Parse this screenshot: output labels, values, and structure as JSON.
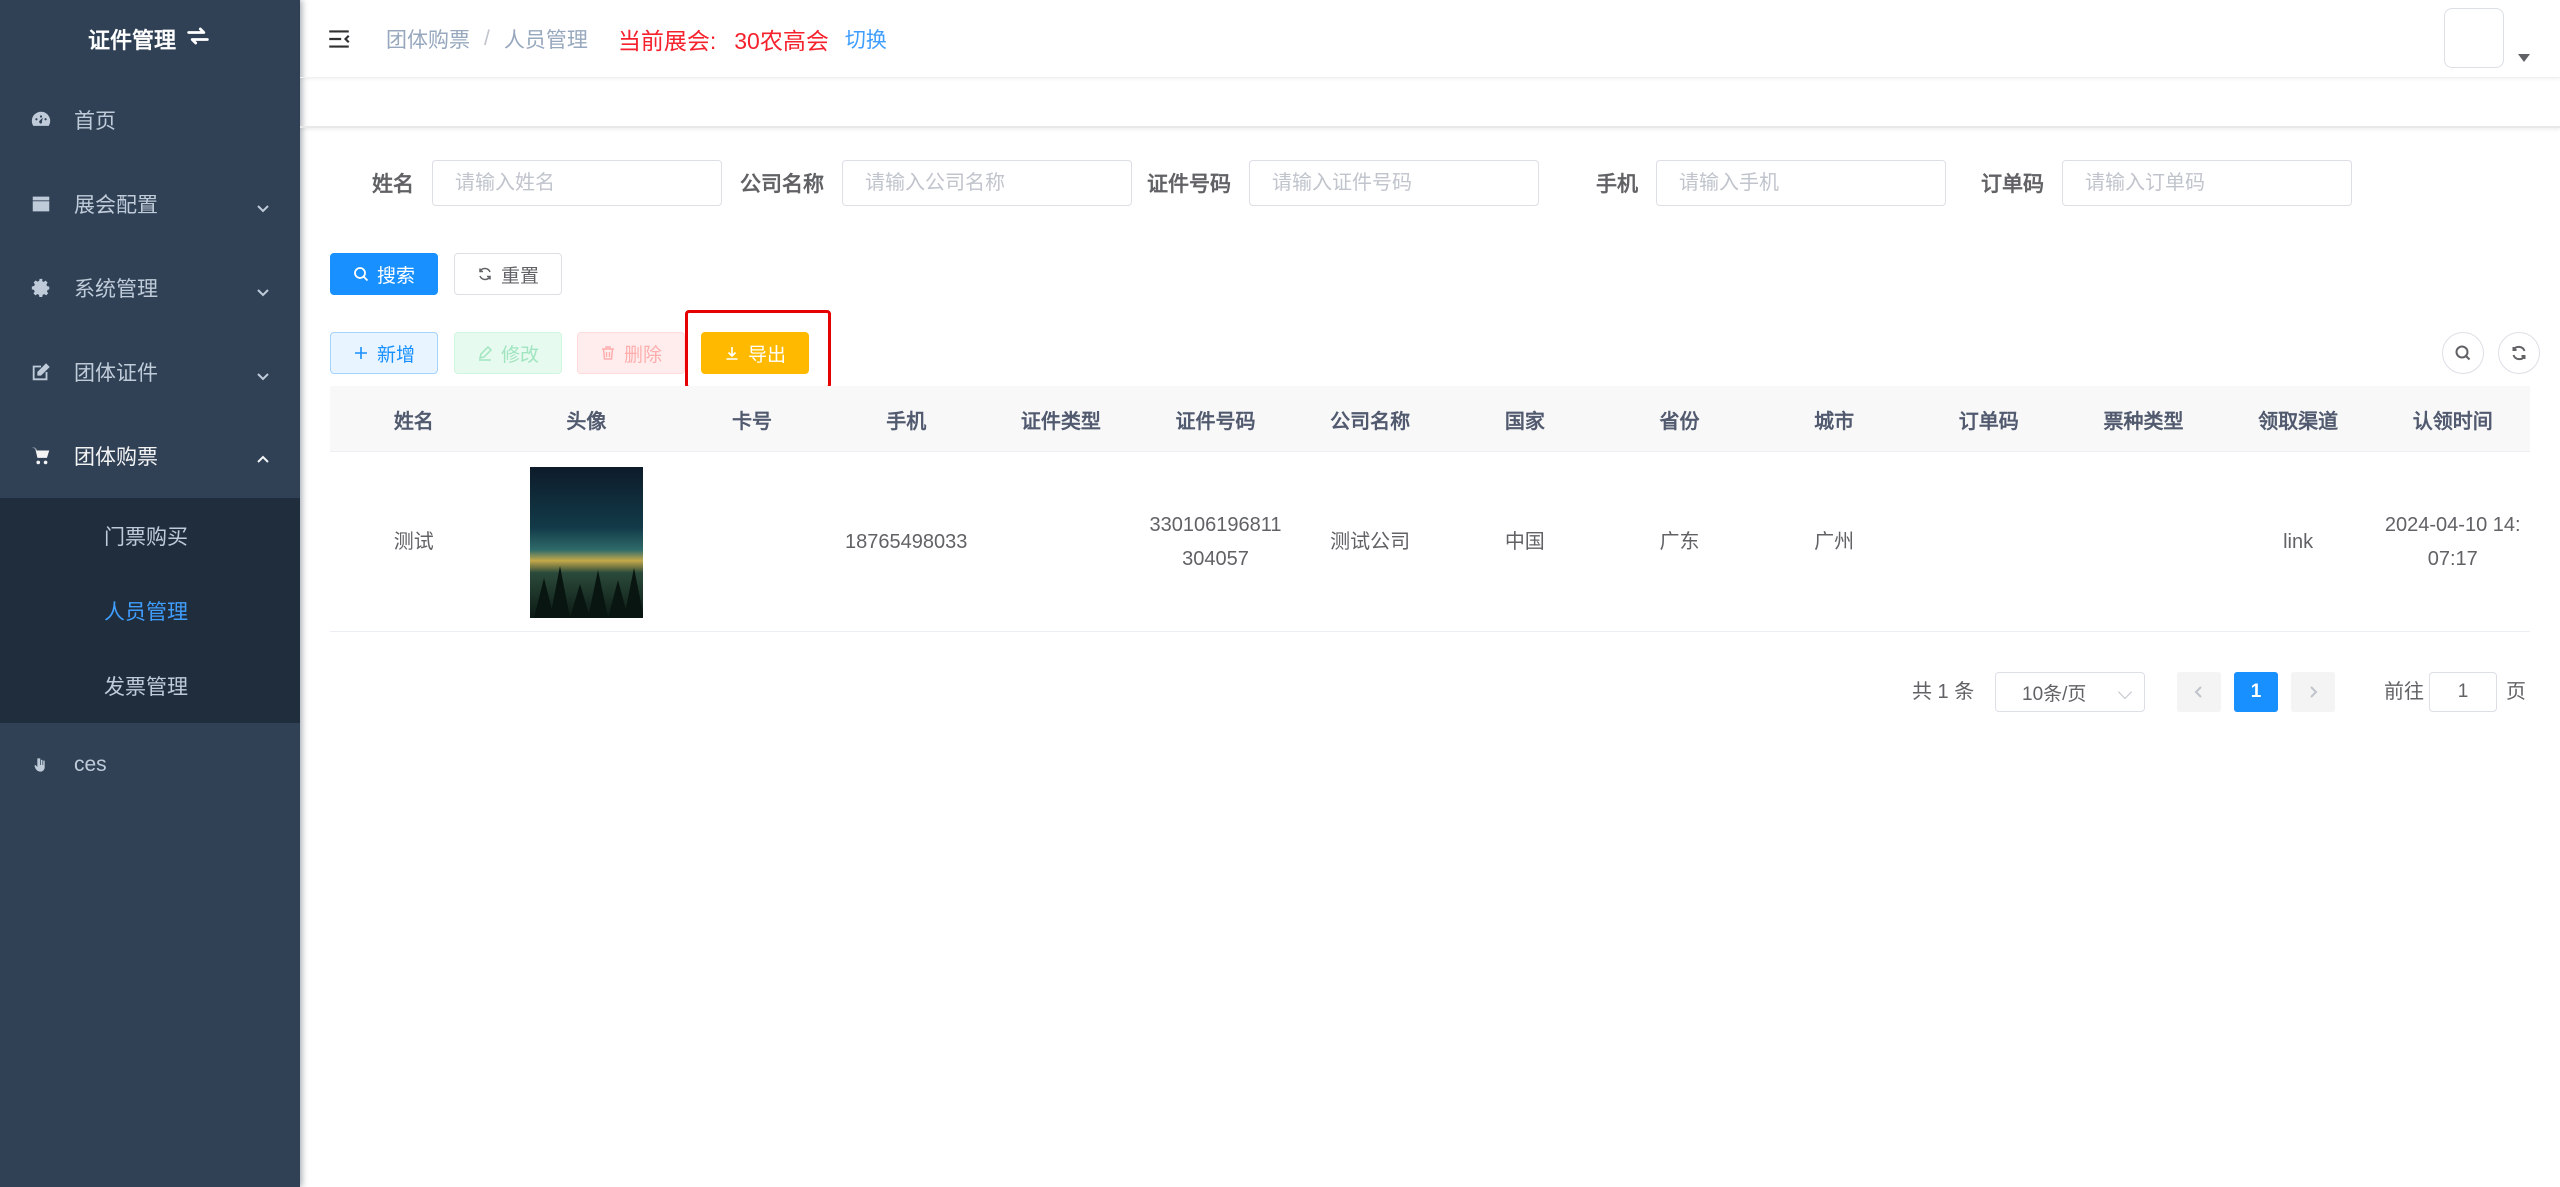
{
  "sidebar": {
    "logo_text": "证件管理",
    "menu": [
      {
        "label": "首页",
        "icon": "dashboard-icon"
      },
      {
        "label": "展会配置",
        "icon": "clapperboard-icon"
      },
      {
        "label": "系统管理",
        "icon": "gear-icon"
      },
      {
        "label": "团体证件",
        "icon": "edit-icon"
      },
      {
        "label": "团体购票",
        "icon": "cart-icon"
      },
      {
        "label": "ces",
        "icon": "hand-icon"
      }
    ],
    "submenu": [
      {
        "label": "门票购买"
      },
      {
        "label": "人员管理"
      },
      {
        "label": "发票管理"
      }
    ]
  },
  "header": {
    "breadcrumb": [
      "团体购票",
      "人员管理"
    ],
    "breadcrumb_sep": "/",
    "exhibition_label": "当前展会:",
    "exhibition_value": "30农高会",
    "switch_label": "切换"
  },
  "filters": [
    {
      "label": "姓名",
      "placeholder": "请输入姓名"
    },
    {
      "label": "公司名称",
      "placeholder": "请输入公司名称"
    },
    {
      "label": "证件号码",
      "placeholder": "请输入证件号码"
    },
    {
      "label": "手机",
      "placeholder": "请输入手机"
    },
    {
      "label": "订单码",
      "placeholder": "请输入订单码"
    }
  ],
  "buttons": {
    "search": "搜索",
    "reset": "重置",
    "add": "新增",
    "edit": "修改",
    "delete": "删除",
    "export": "导出"
  },
  "table": {
    "columns": [
      "姓名",
      "头像",
      "卡号",
      "手机",
      "证件类型",
      "证件号码",
      "公司名称",
      "国家",
      "省份",
      "城市",
      "订单码",
      "票种类型",
      "领取渠道",
      "认领时间"
    ],
    "rows": [
      {
        "name": "测试",
        "card_no": "",
        "phone": "18765498033",
        "id_type": "",
        "id_no": "330106196811304057",
        "company": "测试公司",
        "country": "中国",
        "province": "广东",
        "city": "广州",
        "order_code": "",
        "ticket_type": "",
        "channel": "link",
        "claim_time": "2024-04-10 14:07:17"
      }
    ]
  },
  "pagination": {
    "total_text": "共 1 条",
    "page_size": "10条/页",
    "current_page": "1",
    "goto_label": "前往",
    "goto_value": "1",
    "page_suffix": "页"
  },
  "colors": {
    "primary": "#1890ff",
    "warning": "#ffba00",
    "sidebar_bg": "#304156",
    "submenu_bg": "#1f2d3d",
    "exhibition_red": "#f5222d",
    "highlight": "#e60000"
  }
}
